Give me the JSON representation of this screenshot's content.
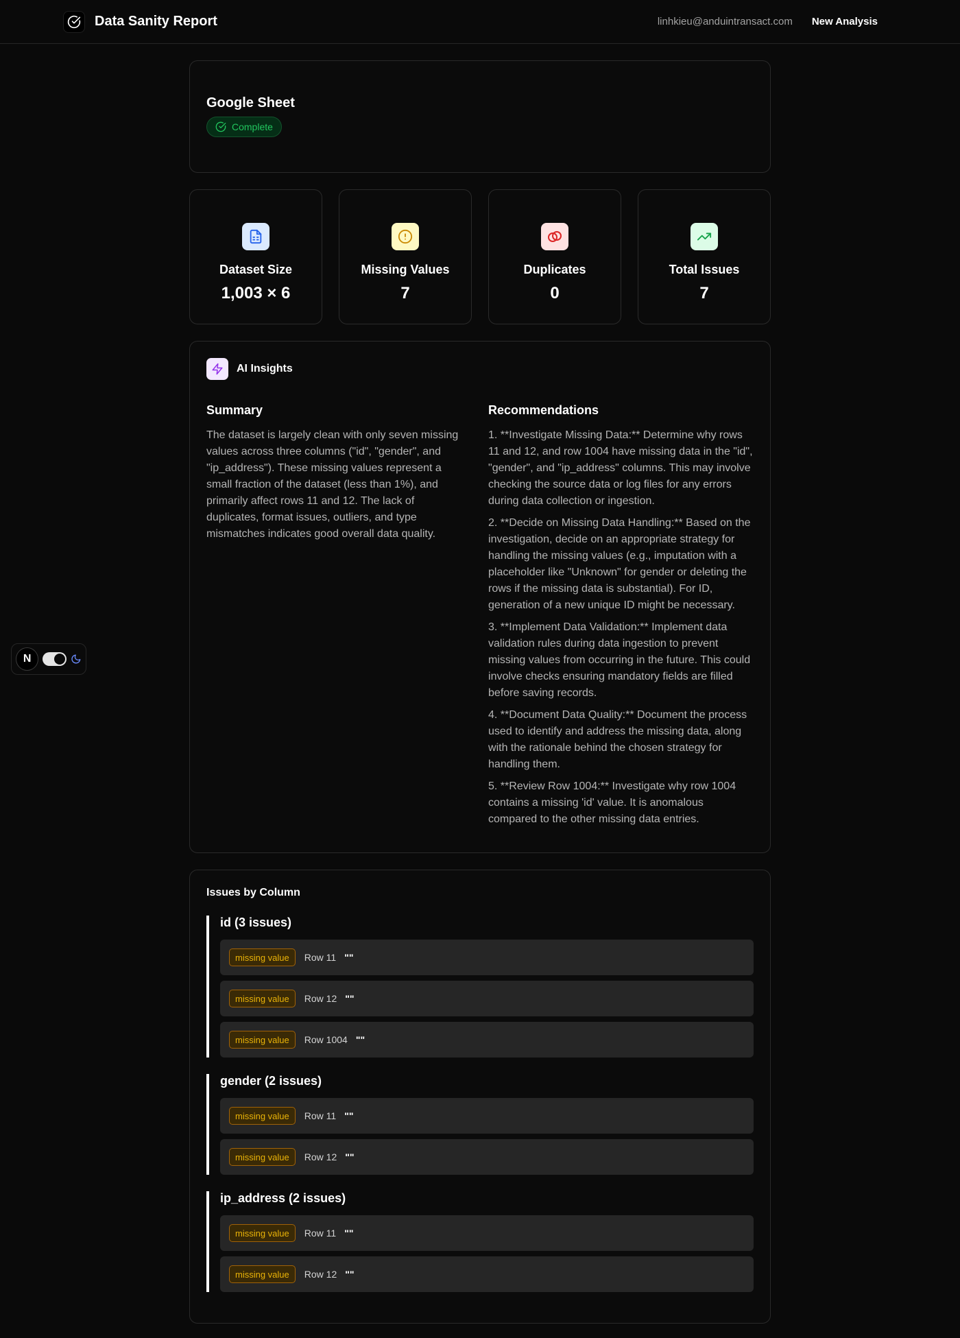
{
  "header": {
    "title": "Data Sanity Report",
    "user_email": "linhkieu@anduintransact.com",
    "new_analysis_label": "New Analysis"
  },
  "source": {
    "title": "Google Sheet",
    "status": "Complete"
  },
  "stats": [
    {
      "label": "Dataset Size",
      "value": "1,003 × 6",
      "icon": "file-spreadsheet-icon",
      "icon_bg": "#dbeafe",
      "icon_color": "#2563eb"
    },
    {
      "label": "Missing Values",
      "value": "7",
      "icon": "alert-circle-icon",
      "icon_bg": "#fef9c3",
      "icon_color": "#ca8a04"
    },
    {
      "label": "Duplicates",
      "value": "0",
      "icon": "copy-icon",
      "icon_bg": "#fee2e2",
      "icon_color": "#dc2626"
    },
    {
      "label": "Total Issues",
      "value": "7",
      "icon": "trending-up-icon",
      "icon_bg": "#dcfce7",
      "icon_color": "#16a34a"
    }
  ],
  "insights": {
    "title": "AI Insights",
    "summary_heading": "Summary",
    "summary": "The dataset is largely clean with only seven missing values across three columns (\"id\", \"gender\", and \"ip_address\"). These missing values represent a small fraction of the dataset (less than 1%), and primarily affect rows 11 and 12. The lack of duplicates, format issues, outliers, and type mismatches indicates good overall data quality.",
    "recommendations_heading": "Recommendations",
    "recommendations": [
      "1. **Investigate Missing Data:** Determine why rows 11 and 12, and row 1004 have missing data in the \"id\", \"gender\", and \"ip_address\" columns. This may involve checking the source data or log files for any errors during data collection or ingestion.",
      "2. **Decide on Missing Data Handling:** Based on the investigation, decide on an appropriate strategy for handling the missing values (e.g., imputation with a placeholder like \"Unknown\" for gender or deleting the rows if the missing data is substantial). For ID, generation of a new unique ID might be necessary.",
      "3. **Implement Data Validation:** Implement data validation rules during data ingestion to prevent missing values from occurring in the future. This could involve checks ensuring mandatory fields are filled before saving records.",
      "4. **Document Data Quality:** Document the process used to identify and address the missing data, along with the rationale behind the chosen strategy for handling them.",
      "5. **Review Row 1004:** Investigate why row 1004 contains a missing 'id' value. It is anomalous compared to the other missing data entries."
    ]
  },
  "issues": {
    "title": "Issues by Column",
    "groups": [
      {
        "title": "id (3 issues)",
        "rows": [
          {
            "badge": "missing value",
            "row": "Row 11",
            "value": "\"\""
          },
          {
            "badge": "missing value",
            "row": "Row 12",
            "value": "\"\""
          },
          {
            "badge": "missing value",
            "row": "Row 1004",
            "value": "\"\""
          }
        ]
      },
      {
        "title": "gender (2 issues)",
        "rows": [
          {
            "badge": "missing value",
            "row": "Row 11",
            "value": "\"\""
          },
          {
            "badge": "missing value",
            "row": "Row 12",
            "value": "\"\""
          }
        ]
      },
      {
        "title": "ip_address (2 issues)",
        "rows": [
          {
            "badge": "missing value",
            "row": "Row 11",
            "value": "\"\""
          },
          {
            "badge": "missing value",
            "row": "Row 12",
            "value": "\"\""
          }
        ]
      }
    ]
  },
  "devtool": {
    "logo": "N"
  }
}
